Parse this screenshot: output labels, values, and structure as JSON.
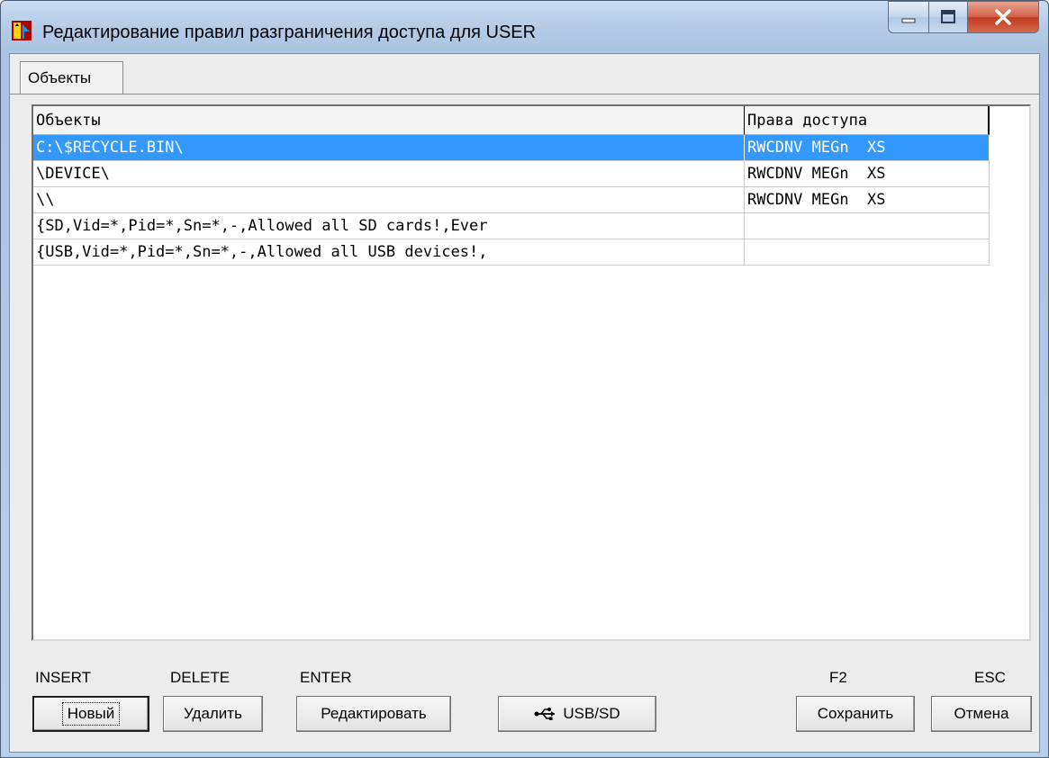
{
  "window": {
    "title": "Редактирование правил разграничения доступа для USER"
  },
  "tabs": [
    {
      "label": "Объекты",
      "active": true
    }
  ],
  "table": {
    "columns": [
      "Объекты",
      "Права доступа"
    ],
    "rows": [
      {
        "object": "C:\\$RECYCLE.BIN\\",
        "rights": "RWCDNV MEGn  XS",
        "selected": true
      },
      {
        "object": "\\DEVICE\\",
        "rights": "RWCDNV MEGn  XS",
        "selected": false
      },
      {
        "object": "\\\\",
        "rights": "RWCDNV MEGn  XS",
        "selected": false
      },
      {
        "object": "{SD,Vid=*,Pid=*,Sn=*,-,Allowed all SD cards!,Ever",
        "rights": "",
        "selected": false
      },
      {
        "object": "{USB,Vid=*,Pid=*,Sn=*,-,Allowed all USB devices!,",
        "rights": "",
        "selected": false
      }
    ]
  },
  "shortcuts": {
    "insert": "INSERT",
    "delete": "DELETE",
    "enter": "ENTER",
    "f2": "F2",
    "esc": "ESC"
  },
  "buttons": {
    "new": "Новый",
    "delete": "Удалить",
    "edit": "Редактировать",
    "usb_sd": "USB/SD",
    "save": "Сохранить",
    "cancel": "Отмена"
  },
  "icons": {
    "app": "app-icon",
    "usb": "usb-icon",
    "minimize": "minimize-icon",
    "maximize": "maximize-icon",
    "close": "close-icon"
  },
  "colors": {
    "selection": "#3399ff",
    "close_button": "#c7432a"
  }
}
